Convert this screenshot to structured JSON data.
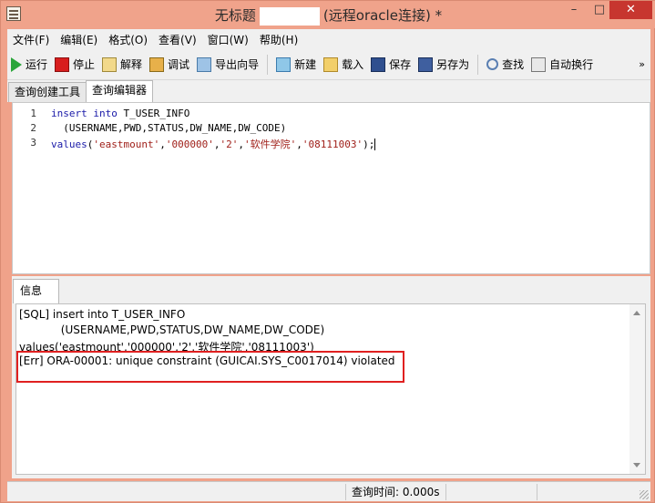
{
  "window": {
    "title_prefix": "无标题",
    "title_suffix": "(远程oracle连接) *",
    "minimize": "–",
    "maximize": "□",
    "close": "✕"
  },
  "menu": [
    {
      "label": "文件(F)"
    },
    {
      "label": "编辑(E)"
    },
    {
      "label": "格式(O)"
    },
    {
      "label": "查看(V)"
    },
    {
      "label": "窗口(W)"
    },
    {
      "label": "帮助(H)"
    }
  ],
  "toolbar": {
    "run": "运行",
    "stop": "停止",
    "explain": "解释",
    "debug": "调试",
    "export_wizard": "导出向导",
    "new": "新建",
    "load": "载入",
    "save": "保存",
    "save_as": "另存为",
    "find": "查找",
    "word_wrap": "自动换行",
    "more": "»"
  },
  "tabs": {
    "query_builder": "查询创建工具",
    "query_editor": "查询编辑器"
  },
  "editor": {
    "line_numbers": [
      "1",
      "2",
      "3"
    ],
    "lines": {
      "l1_kw1": "insert",
      "l1_kw2": "into",
      "l1_rest": "T_USER_INFO",
      "l2": "  (USERNAME,PWD,STATUS,DW_NAME,DW_CODE)",
      "l3_fn": "values",
      "l3_open": "(",
      "l3_s1": "'eastmount'",
      "l3_s2": "'000000'",
      "l3_s3": "'2'",
      "l3_s4": "'软件学院'",
      "l3_s5": "'08111003'",
      "l3_close": ");"
    }
  },
  "info": {
    "tab_label": "信息",
    "messages": [
      "[SQL] insert into T_USER_INFO",
      "            (USERNAME,PWD,STATUS,DW_NAME,DW_CODE)",
      "values('eastmount','000000','2','软件学院','08111003')",
      "[Err] ORA-00001: unique constraint (GUICAI.SYS_C0017014) violated"
    ]
  },
  "status": {
    "query_time": "查询时间: 0.000s"
  },
  "colors": {
    "window_frame": "#f0a28a",
    "close_button": "#c7362f",
    "keyword": "#1a1aa8",
    "string": "#a0201a",
    "error_highlight": "#e02020"
  }
}
